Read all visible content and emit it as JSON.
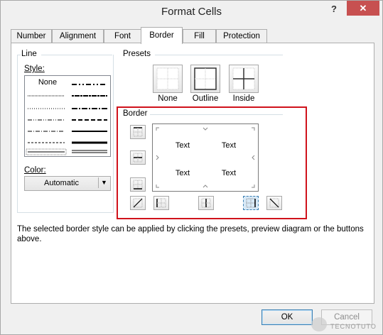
{
  "window": {
    "title": "Format Cells",
    "help_label": "?",
    "close_label": "✕"
  },
  "tabs": [
    {
      "label": "Number"
    },
    {
      "label": "Alignment"
    },
    {
      "label": "Font"
    },
    {
      "label": "Border",
      "active": true
    },
    {
      "label": "Fill"
    },
    {
      "label": "Protection"
    }
  ],
  "line": {
    "group_label": "Line",
    "style_label": "Style:",
    "none_label": "None",
    "color_label": "Color:",
    "color_value": "Automatic"
  },
  "presets": {
    "group_label": "Presets",
    "items": [
      {
        "label": "None",
        "icon": "preset-none-icon"
      },
      {
        "label": "Outline",
        "icon": "preset-outline-icon"
      },
      {
        "label": "Inside",
        "icon": "preset-inside-icon"
      }
    ]
  },
  "border": {
    "group_label": "Border",
    "preview_texts": [
      "Text",
      "Text",
      "Text",
      "Text"
    ],
    "highlight_color": "#d0121b"
  },
  "info_text": "The selected border style can be applied by clicking the presets, preview diagram or the buttons above.",
  "footer": {
    "ok_label": "OK",
    "cancel_label": "Cancel"
  },
  "watermark": "TECNOTUTO"
}
